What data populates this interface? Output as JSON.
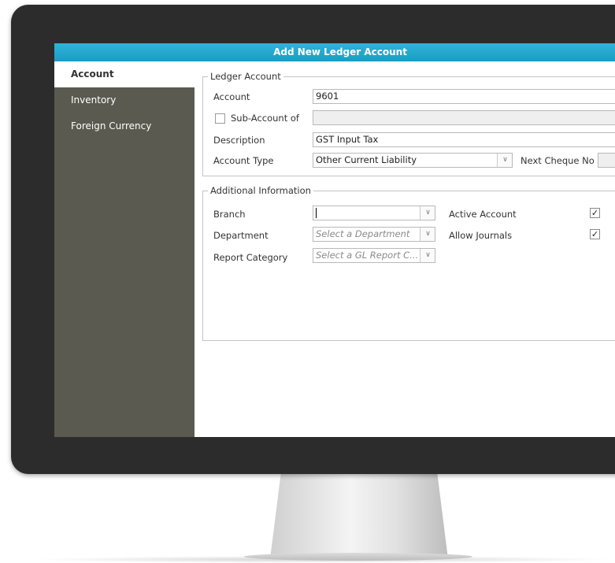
{
  "window": {
    "title": "Add New Ledger Account"
  },
  "sidebar": {
    "items": [
      {
        "label": "Account",
        "active": true
      },
      {
        "label": "Inventory",
        "active": false
      },
      {
        "label": "Foreign Currency",
        "active": false
      }
    ]
  },
  "ledger": {
    "legend": "Ledger Account",
    "account_label": "Account",
    "account_value": "9601",
    "sub_account_label": "Sub-Account of",
    "sub_account_checked": false,
    "sub_account_value": "",
    "description_label": "Description",
    "description_value": "GST Input Tax",
    "account_type_label": "Account Type",
    "account_type_value": "Other Current Liability",
    "next_cheque_label": "Next Cheque No",
    "next_cheque_value": ""
  },
  "additional": {
    "legend": "Additional Information",
    "branch_label": "Branch",
    "branch_value": "",
    "department_label": "Department",
    "department_placeholder": "Select a Department",
    "report_category_label": "Report Category",
    "report_category_placeholder": "Select a GL Report C...",
    "active_account_label": "Active Account",
    "active_account_checked": true,
    "allow_journals_label": "Allow Journals",
    "allow_journals_checked": true
  },
  "icons": {
    "dropdown": "chevron-down-icon",
    "check": "checkmark-icon"
  },
  "colors": {
    "title_bar": "#1fa8d0",
    "sidebar_bg": "#5a5a50",
    "monitor_bezel": "#2c2c2c"
  }
}
